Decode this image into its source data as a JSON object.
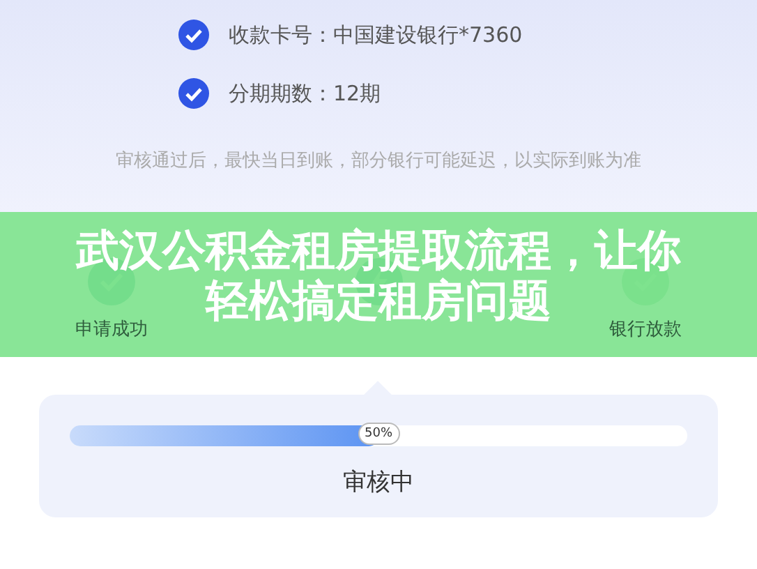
{
  "details": [
    {
      "label": "收款卡号：",
      "value": "中国建设银行*7360",
      "checked": true
    },
    {
      "label": "分期期数：",
      "value": "12期",
      "checked": true
    }
  ],
  "note": "审核通过后，最快当日到账，部分银行可能延迟，以实际到账为准",
  "steps": [
    {
      "kind": "done",
      "label": "申请成功"
    },
    {
      "kind": "current"
    },
    {
      "kind": "pending",
      "label": "银行放款"
    }
  ],
  "banner": {
    "title": "武汉公积金租房提取流程，让你轻松搞定租房问题"
  },
  "progress": {
    "level": 0.5,
    "reading": "50%",
    "status": "审核中"
  }
}
